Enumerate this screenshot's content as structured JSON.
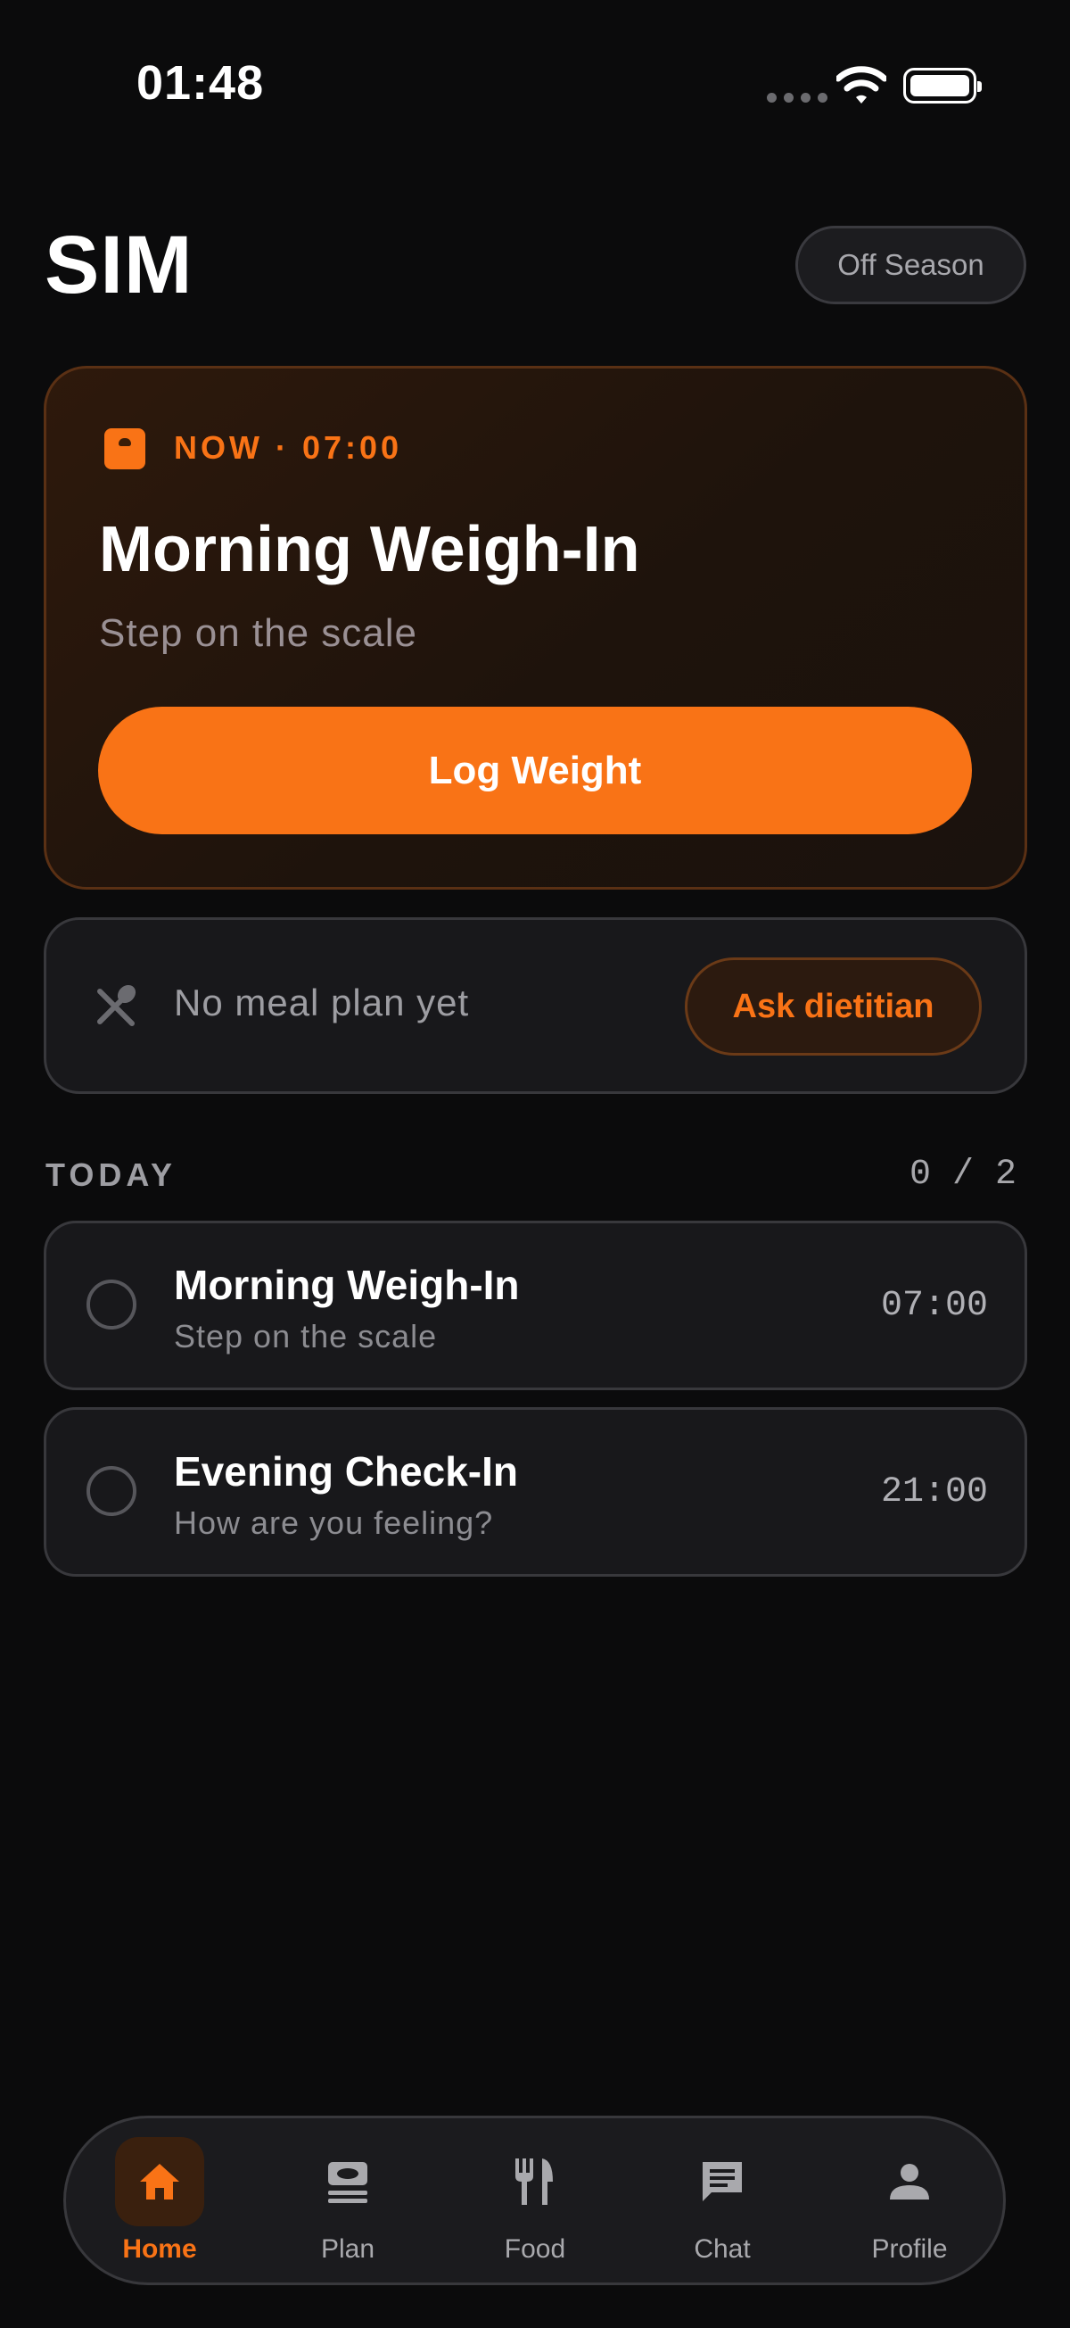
{
  "status_bar": {
    "time": "01:48"
  },
  "header": {
    "app_title": "SIM",
    "season_pill": "Off Season"
  },
  "now_card": {
    "label": "NOW · 07:00",
    "title": "Morning Weigh-In",
    "subtitle": "Step on the scale",
    "action_label": "Log Weight",
    "icon": "scale-icon"
  },
  "meal_card": {
    "text": "No meal plan yet",
    "action_label": "Ask dietitian",
    "icon": "utensils-icon"
  },
  "today": {
    "label": "TODAY",
    "count": "0 / 2",
    "tasks": [
      {
        "title": "Morning Weigh-In",
        "subtitle": "Step on the scale",
        "time": "07:00",
        "done": false
      },
      {
        "title": "Evening Check-In",
        "subtitle": "How are you feeling?",
        "time": "21:00",
        "done": false
      }
    ]
  },
  "nav": {
    "items": [
      {
        "label": "Home",
        "icon": "home-icon",
        "active": true
      },
      {
        "label": "Plan",
        "icon": "plan-icon",
        "active": false
      },
      {
        "label": "Food",
        "icon": "fork-knife-icon",
        "active": false
      },
      {
        "label": "Chat",
        "icon": "chat-icon",
        "active": false
      },
      {
        "label": "Profile",
        "icon": "person-icon",
        "active": false
      }
    ]
  },
  "colors": {
    "accent": "#f97316",
    "background": "#0b0b0c",
    "card": "#18181b"
  }
}
